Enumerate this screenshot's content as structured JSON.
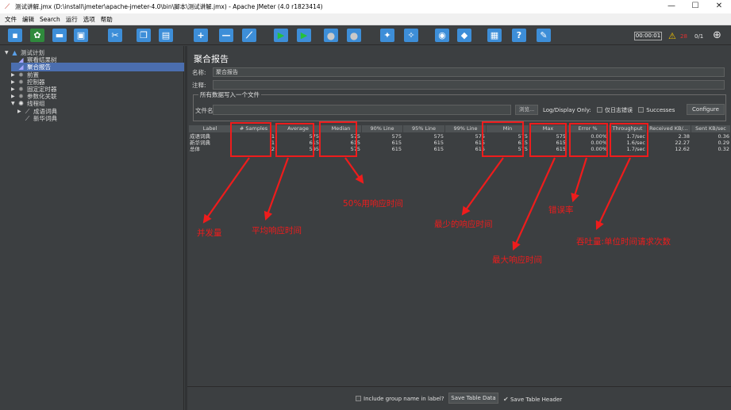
{
  "window": {
    "title": "测试讲解.jmx (D:\\install\\jmeter\\apache-jmeter-4.0\\bin\\脚本\\测试讲解.jmx) - Apache JMeter (4.0 r1823414)",
    "minimize_glyph": "—",
    "maximize_glyph": "☐",
    "close_glyph": "✕"
  },
  "menu": [
    "文件",
    "编辑",
    "Search",
    "运行",
    "选项",
    "帮助"
  ],
  "toolbar": {
    "timer": "00:00:01",
    "warning_count": "28",
    "threads": "0/1",
    "icons": [
      "new-icon",
      "templates-icon",
      "open-icon",
      "save-icon",
      "cut-icon",
      "copy-icon",
      "paste-icon",
      "expand-icon",
      "collapse-icon",
      "toggle-icon",
      "start-icon",
      "start-no-pause-icon",
      "stop-icon",
      "shutdown-icon",
      "clear-icon",
      "clear-all-icon",
      "search-icon",
      "reset-search-icon",
      "function-helper-icon",
      "help-icon",
      "remote-icon"
    ],
    "glyphs": {
      "plus": "+",
      "minus": "—",
      "toggle": "⟋",
      "start": "▶",
      "stop": "●",
      "shutdown": "●",
      "warn": "⚠",
      "globe": "⊕"
    }
  },
  "tree": [
    {
      "label": "测试计划",
      "depth": 0,
      "expander": "▼",
      "icon": "test-plan-icon",
      "selected": false
    },
    {
      "label": "察看结果树",
      "depth": 1,
      "expander": "",
      "icon": "listener-icon",
      "selected": false
    },
    {
      "label": "聚合报告",
      "depth": 1,
      "expander": "",
      "icon": "listener-icon",
      "selected": true
    },
    {
      "label": "前置",
      "depth": 1,
      "expander": "▶",
      "icon": "gear-icon",
      "selected": false
    },
    {
      "label": "控制器",
      "depth": 1,
      "expander": "▶",
      "icon": "gear-icon",
      "selected": false
    },
    {
      "label": "固定定时器",
      "depth": 1,
      "expander": "▶",
      "icon": "gear-icon",
      "selected": false
    },
    {
      "label": "参数化关联",
      "depth": 1,
      "expander": "▶",
      "icon": "gear-icon",
      "selected": false
    },
    {
      "label": "线程组",
      "depth": 1,
      "expander": "▼",
      "icon": "thread-group-icon",
      "selected": false
    },
    {
      "label": "成语词典",
      "depth": 2,
      "expander": "▶",
      "icon": "sampler-icon",
      "selected": false
    },
    {
      "label": "新华词典",
      "depth": 2,
      "expander": "",
      "icon": "sampler-icon",
      "selected": false
    }
  ],
  "panel": {
    "title": "聚合报告",
    "name_label": "名称:",
    "name_value": "聚合报告",
    "comment_label": "注释:",
    "comment_value": "",
    "file_section": "所有数据写入一个文件",
    "filename_label": "文件名",
    "browse_label": "浏览...",
    "log_display_label": "Log/Display Only:",
    "errors_only_label": "仅日志错误",
    "successes_label": "Successes",
    "configure_label": "Configure"
  },
  "table": {
    "columns": [
      "Label",
      "# Samples",
      "Average",
      "Median",
      "90% Line",
      "95% Line",
      "99% Line",
      "Min",
      "Max",
      "Error %",
      "Throughput",
      "Received KB/...",
      "Sent KB/sec"
    ],
    "rows": [
      [
        "成语词典",
        "1",
        "575",
        "575",
        "575",
        "575",
        "575",
        "575",
        "575",
        "0.00%",
        "1.7/sec",
        "2.38",
        "0.36"
      ],
      [
        "新华词典",
        "1",
        "615",
        "615",
        "615",
        "615",
        "615",
        "615",
        "615",
        "0.00%",
        "1.6/sec",
        "22.27",
        "0.29"
      ],
      [
        "总体",
        "2",
        "595",
        "575",
        "615",
        "615",
        "615",
        "575",
        "615",
        "0.00%",
        "1.7/sec",
        "12.62",
        "0.32"
      ]
    ]
  },
  "annotations": {
    "samples": "并发量",
    "average": "平均响应时间",
    "median": "50%用响应时间",
    "min": "最少的响应时间",
    "max": "最大响应时间",
    "error": "错误率",
    "throughput": "吞吐量:单位时间请求次数"
  },
  "bottom": {
    "include_group_label": "Include group name in label?",
    "save_table_data_label": "Save Table Data",
    "save_table_header_label": "Save Table Header",
    "check_glyph": "✔"
  },
  "colors": {
    "background": "#3c3f41",
    "selection": "#4b6eaf",
    "annotation_red": "#ee1c1c"
  }
}
